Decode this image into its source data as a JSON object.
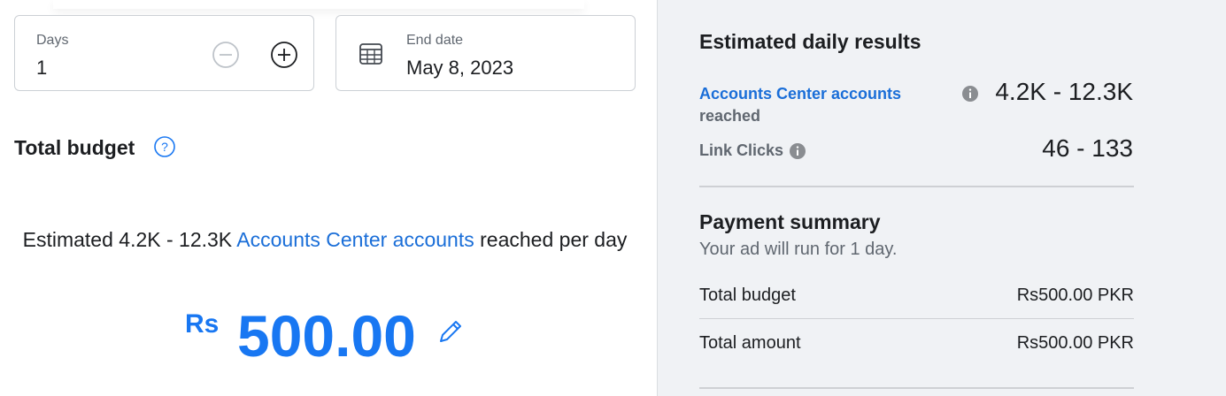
{
  "duration": {
    "days_label": "Days",
    "days_value": "1",
    "minus_icon": "minus-circle-icon",
    "plus_icon": "plus-circle-icon",
    "end_date_label": "End date",
    "end_date_value": "May 8, 2023",
    "calendar_icon": "calendar-icon"
  },
  "budget": {
    "title": "Total budget",
    "help_icon": "question-circle-icon",
    "estimate_prefix": "Estimated 4.2K - 12.3K ",
    "estimate_link": "Accounts Center accounts",
    "estimate_suffix": " reached per day",
    "currency": "Rs",
    "amount": "500.00",
    "edit_icon": "pencil-icon"
  },
  "results": {
    "title": "Estimated daily results",
    "metric1_link": "Accounts Center accounts",
    "metric1_sub": "reached",
    "metric1_value": "4.2K - 12.3K",
    "metric2_label": "Link Clicks",
    "metric2_value": "46 - 133",
    "info_icon": "info-icon"
  },
  "payment": {
    "title": "Payment summary",
    "subtitle": "Your ad will run for 1 day.",
    "rows": [
      {
        "label": "Total budget",
        "value": "Rs500.00 PKR"
      },
      {
        "label": "Total amount",
        "value": "Rs500.00 PKR"
      }
    ]
  },
  "colors": {
    "accent": "#1877f2",
    "link": "#1a6ed8",
    "panel_bg": "#f0f2f5",
    "text_primary": "#1c1e21",
    "text_secondary": "#606770"
  }
}
